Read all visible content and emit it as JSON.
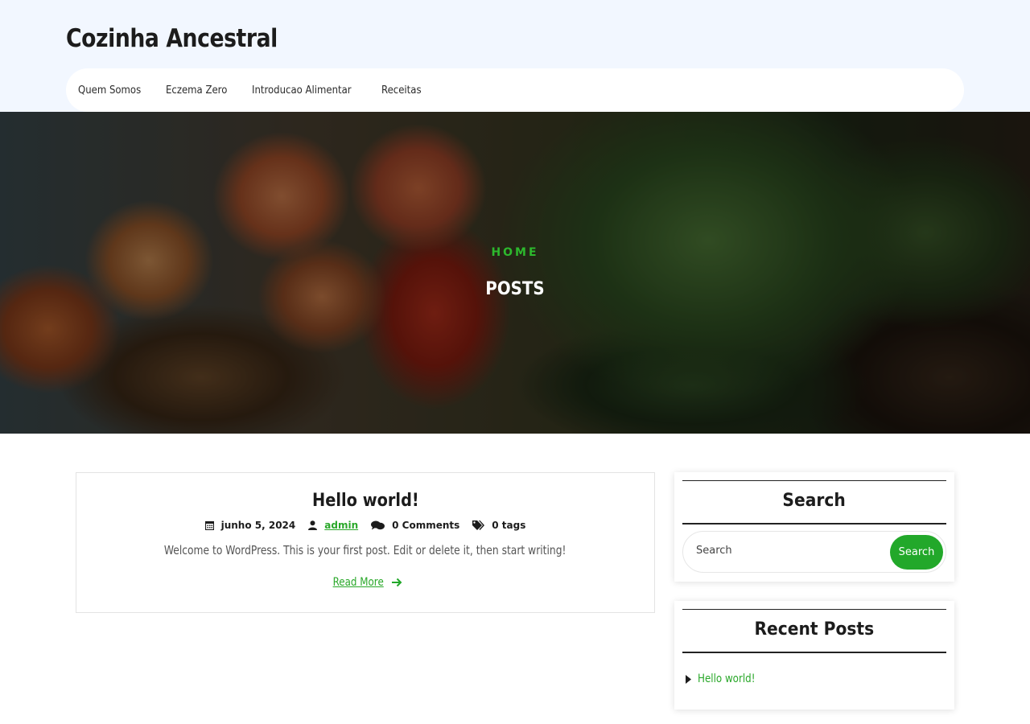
{
  "site": {
    "title": "Cozinha Ancestral"
  },
  "nav": {
    "items": [
      "Quem Somos",
      "Eczema Zero",
      "Introducao Alimentar",
      "Receitas"
    ]
  },
  "hero": {
    "breadcrumb": "HOME",
    "title": "POSTS"
  },
  "post": {
    "title": "Hello world!",
    "date": "junho 5, 2024",
    "author": "admin",
    "comments": "0 Comments",
    "tags": "0 tags",
    "excerpt": "Welcome to WordPress. This is your first post. Edit or delete it, then start writing!",
    "read_more": "Read More"
  },
  "sidebar": {
    "search": {
      "title": "Search",
      "placeholder": "Search",
      "button": "Search"
    },
    "recent": {
      "title": "Recent Posts",
      "items": [
        "Hello world!"
      ]
    }
  },
  "colors": {
    "accent": "#22a82a",
    "header_bg": "#f2f7ff",
    "text": "#1c1c1c"
  }
}
